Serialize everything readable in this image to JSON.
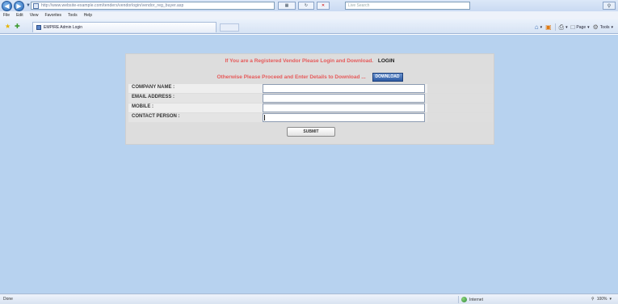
{
  "browser": {
    "url": "http://www.website-example.com/tenders/vendorlogin/vendor_reg_buyer.asp",
    "search_placeholder": "Live Search",
    "menu": [
      "File",
      "Edit",
      "View",
      "Favorites",
      "Tools",
      "Help"
    ],
    "tab_title": "EMPIRE Admin Login",
    "toolbar": {
      "page_label": "Page",
      "tools_label": "Tools"
    }
  },
  "notice": {
    "line1": "If You are a Registered Vendor Please Login and Download.",
    "login_label": "LOGIN",
    "line2": "Otherwise Please Proceed and Enter Details to Download ...",
    "download_label": "DOWNLOAD"
  },
  "form": {
    "fields": [
      {
        "label": "COMPANY NAME :",
        "value": ""
      },
      {
        "label": "EMAIL ADDRESS :",
        "value": ""
      },
      {
        "label": "MOBILE :",
        "value": ""
      },
      {
        "label": "CONTACT PERSON :",
        "value": ""
      }
    ],
    "submit_label": "SUBMIT"
  },
  "status": {
    "text": "Done",
    "zone": "Internet",
    "zoom": "100%"
  },
  "colors": {
    "page_background": "#b7d2ef",
    "panel_background": "#dddddd",
    "notice_text": "#e65a5a"
  }
}
